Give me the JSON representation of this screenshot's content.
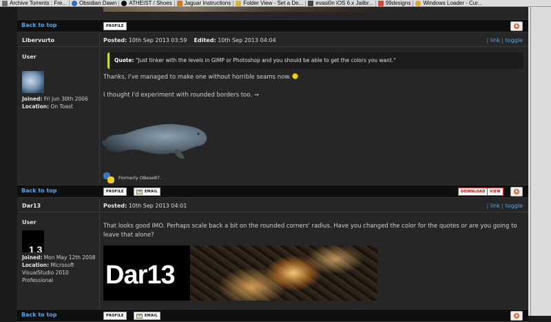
{
  "bookmarks": [
    {
      "label": "Archive Torrents : Fre..."
    },
    {
      "label": "Obsidian Dawn"
    },
    {
      "label": "ATHEIST / Shoes"
    },
    {
      "label": "Jaguar Instructions"
    },
    {
      "label": "Folder View - Set a De..."
    },
    {
      "label": "evasi0n iOS 6.x Jailbr..."
    },
    {
      "label": "99designs"
    },
    {
      "label": "Windows Loader - Cur..."
    }
  ],
  "post_bar": {
    "back_to_top": "Back to top",
    "profile": "PROFILE",
    "email": "EMAIL",
    "download": "DOWNLOAD",
    "view": "VIEW"
  },
  "posts": [
    {
      "author": "Libervurto",
      "rank": "User",
      "joined_label": "Joined:",
      "joined": "Fri Jun 30th 2006",
      "location_label": "Location:",
      "location": "On Toast",
      "posted_label": "Posted:",
      "posted": "10th Sep 2013 03:59",
      "edited_label": "Edited:",
      "edited": "10th Sep 2013 04:04",
      "link": "link",
      "toggle": "toggle",
      "quote_label": "Quote:",
      "quote": "\"Just tinker with the levels in GIMP or Photoshop and you should be able to get the colors you want.\"",
      "line1": "Thanks, I've managed to make one without horrible seams now.",
      "line2": "I thought I'd experiment with rounded borders too. →",
      "signature": "Formerly OBese87."
    },
    {
      "author": "Dar13",
      "rank": "User",
      "joined_label": "Joined:",
      "joined": "Mon May 12th 2008",
      "location_label": "Location:",
      "location": "Microsoft VisualStudio 2010 Professional",
      "posted_label": "Posted:",
      "posted": "10th Sep 2013 04:01",
      "link": "link",
      "toggle": "toggle",
      "body": "That looks good IMO. Perhaps scale back a bit on the rounded corners' radius. Have you changed the color for the quotes or are you going to leave that alone?",
      "banner_text": "Dar13"
    }
  ]
}
